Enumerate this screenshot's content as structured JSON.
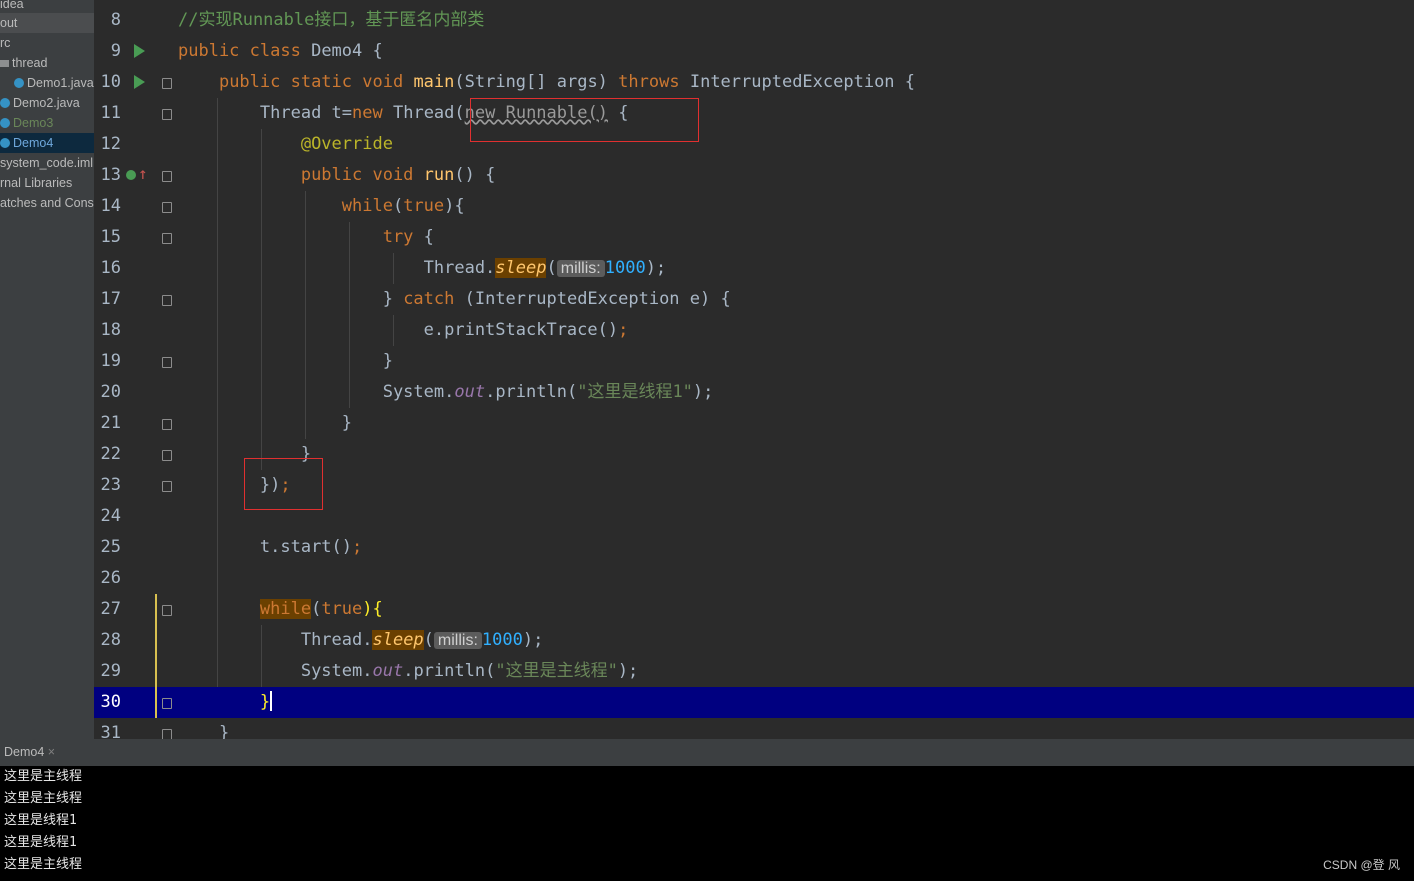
{
  "sidebar": {
    "items": [
      {
        "label": "idea"
      },
      {
        "label": "out"
      },
      {
        "label": "rc"
      },
      {
        "label": "thread"
      },
      {
        "label": "Demo1.java"
      },
      {
        "label": "Demo2.java"
      },
      {
        "label": "Demo3"
      },
      {
        "label": "Demo4"
      },
      {
        "label": "system_code.iml"
      },
      {
        "label": "rnal Libraries"
      },
      {
        "label": "atches and Consoles"
      }
    ]
  },
  "editor": {
    "line_numbers": [
      "8",
      "9",
      "10",
      "11",
      "12",
      "13",
      "14",
      "15",
      "16",
      "17",
      "18",
      "19",
      "20",
      "21",
      "22",
      "23",
      "24",
      "25",
      "26",
      "27",
      "28",
      "29",
      "30",
      "31"
    ],
    "current_line": "30",
    "comment": "//实现Runnable接口，基于匿名内部类",
    "class_decl": {
      "kw": "public class",
      "name": "Demo4",
      "brace": "{"
    },
    "main_decl": {
      "kw": "public static void",
      "name": "main",
      "params": "(String[] args)",
      "throws": "throws",
      "exc": "InterruptedException {"
    },
    "thread_decl": {
      "pre": "Thread t=",
      "kw_new": "new",
      "cls": "Thread",
      "paren": "(",
      "anon": "new Runnable()",
      "brace": " {"
    },
    "override": "@Override",
    "run_decl": {
      "kw": "public void",
      "name": "run",
      "rest": "() {"
    },
    "while1": {
      "kw": "while",
      "paren_open": "(",
      "val": "true",
      "rest": "){"
    },
    "try_line": {
      "kw": "try",
      "rest": " {"
    },
    "sleep1": {
      "obj": "Thread.",
      "method": "sleep",
      "open": "(",
      "hint": "millis:",
      "arg": "1000",
      "close": ");"
    },
    "catch_line": {
      "pre": "} ",
      "kw": "catch",
      "rest": " (InterruptedException e) {"
    },
    "print_trace": {
      "text": "e.printStackTrace()",
      "semi": ";"
    },
    "close_brace": "}",
    "println1": {
      "obj": "System.",
      "field": "out",
      "call": ".println(",
      "str": "\"这里是线程1\"",
      "close": ");"
    },
    "close_anon": {
      "text": "})",
      "semi": ";"
    },
    "start_call": {
      "text": "t.start()",
      "semi": ";"
    },
    "while2": {
      "kw": "while",
      "paren_open": "(",
      "val": "true",
      "rest": "){"
    },
    "sleep2": {
      "obj": "Thread.",
      "method": "sleep",
      "open": "(",
      "hint": "millis:",
      "arg": "1000",
      "close": ");"
    },
    "println2": {
      "obj": "System.",
      "field": "out",
      "call": ".println(",
      "str": "\"这里是主线程\"",
      "close": ");"
    }
  },
  "console": {
    "tab_label": "Demo4",
    "tab_close": "×",
    "lines": [
      "这里是主线程",
      "这里是主线程",
      "这里是线程1",
      "这里是线程1",
      "这里是主线程"
    ]
  },
  "watermark": "CSDN @登 风"
}
